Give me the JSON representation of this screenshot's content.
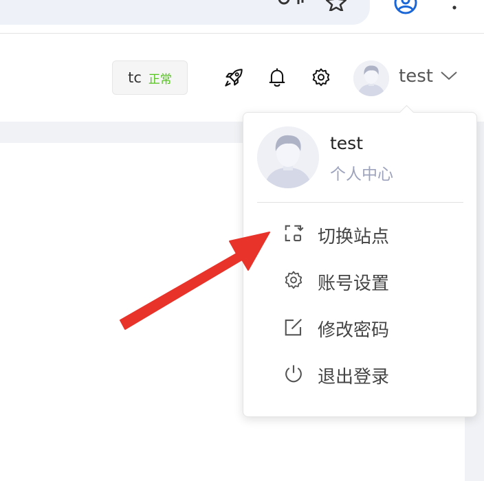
{
  "header": {
    "status": {
      "name": "tc",
      "state": "正常",
      "state_color": "#52c41a"
    },
    "icons": [
      "rocket-icon",
      "bell-icon",
      "gear-icon"
    ],
    "username": "test"
  },
  "dropdown": {
    "username": "test",
    "subtitle": "个人中心",
    "items": [
      {
        "label": "切换站点",
        "icon": "switch-site-icon"
      },
      {
        "label": "账号设置",
        "icon": "gear-icon"
      },
      {
        "label": "修改密码",
        "icon": "edit-icon"
      },
      {
        "label": "退出登录",
        "icon": "power-icon"
      }
    ]
  },
  "annotation": {
    "type": "arrow",
    "color": "#e8332a"
  }
}
